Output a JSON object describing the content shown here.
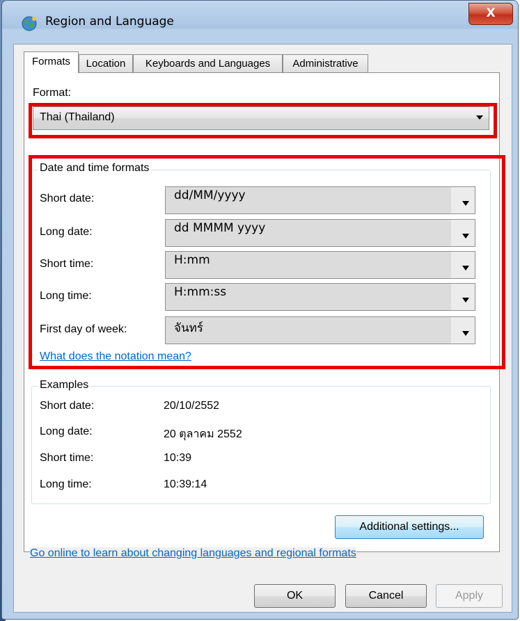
{
  "window": {
    "title": "Region and Language",
    "close_label": "X"
  },
  "tabs": [
    {
      "label": "Formats"
    },
    {
      "label": "Location"
    },
    {
      "label": "Keyboards and Languages"
    },
    {
      "label": "Administrative"
    }
  ],
  "format": {
    "label": "Format:",
    "value": "Thai (Thailand)"
  },
  "datetime": {
    "group_label": "Date and time formats",
    "rows": [
      {
        "label": "Short date:",
        "value": "dd/MM/yyyy"
      },
      {
        "label": "Long date:",
        "value": "dd MMMM yyyy"
      },
      {
        "label": "Short time:",
        "value": "H:mm"
      },
      {
        "label": "Long time:",
        "value": "H:mm:ss"
      },
      {
        "label": "First day of week:",
        "value": "จันทร์"
      }
    ],
    "notation_link": "What does the notation mean?"
  },
  "examples": {
    "group_label": "Examples",
    "rows": [
      {
        "label": "Short date:",
        "value": "20/10/2552"
      },
      {
        "label": "Long date:",
        "value": "20 ตุลาคม 2552"
      },
      {
        "label": "Short time:",
        "value": "10:39"
      },
      {
        "label": "Long time:",
        "value": "10:39:14"
      }
    ]
  },
  "additional_settings": "Additional settings...",
  "online_link": "Go online to learn about changing languages and regional formats",
  "buttons": {
    "ok": "OK",
    "cancel": "Cancel",
    "apply": "Apply"
  },
  "colors": {
    "highlight": "#e60000",
    "link": "#0066cc",
    "close": "#c8432b"
  }
}
